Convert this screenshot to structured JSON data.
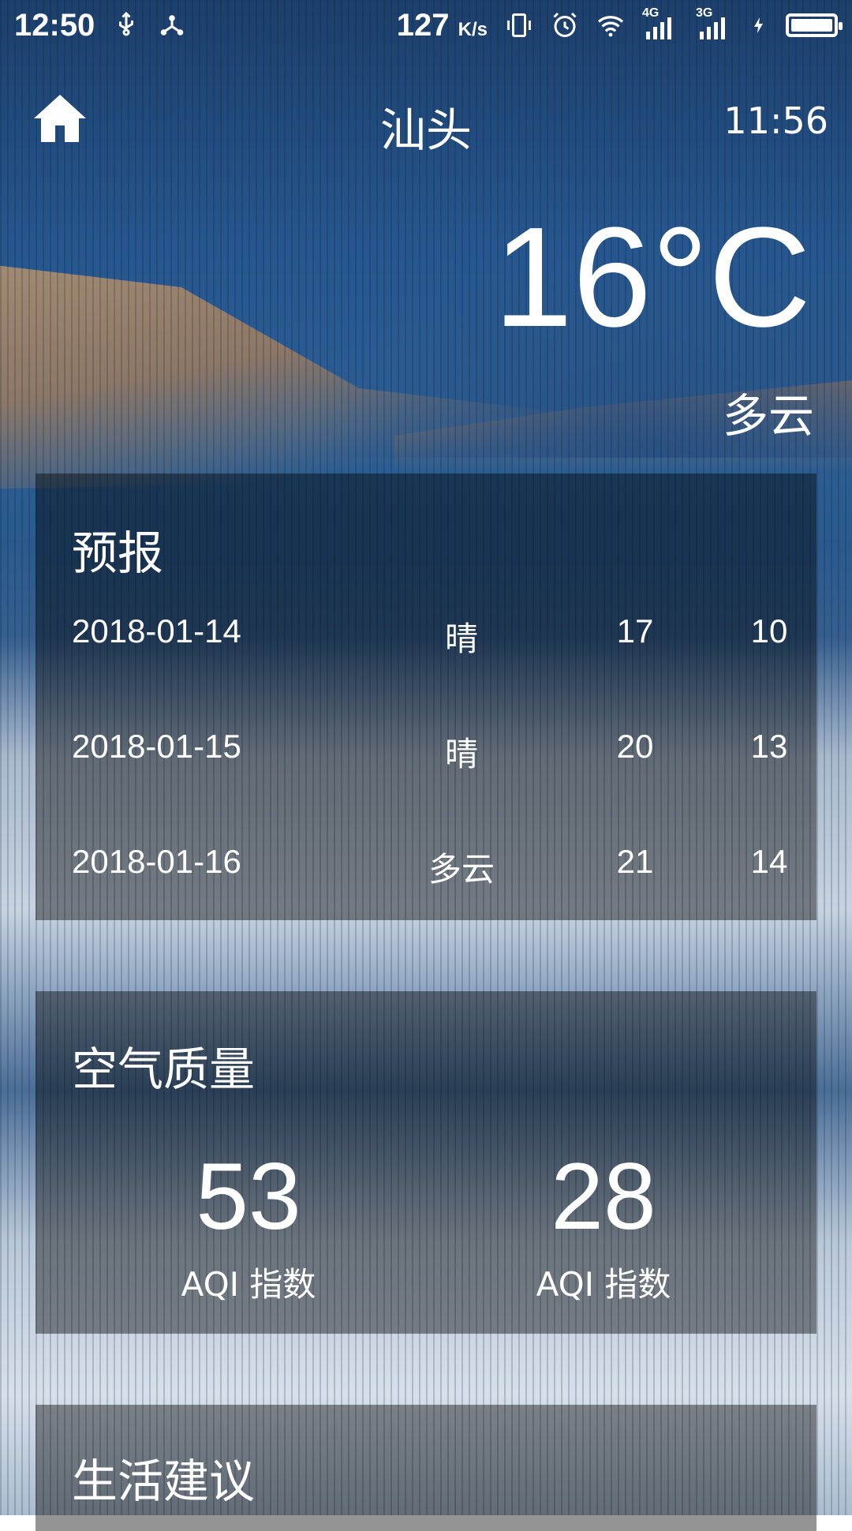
{
  "status_bar": {
    "time": "12:50",
    "net_speed": "127",
    "net_unit": "K/s",
    "signal_1": "4G",
    "signal_2": "3G"
  },
  "header": {
    "city": "汕头",
    "update_time": "11:56"
  },
  "current": {
    "temperature": "16°C",
    "condition": "多云"
  },
  "forecast": {
    "title": "预报",
    "rows": [
      {
        "date": "2018-01-14",
        "cond": "晴",
        "max": "17",
        "min": "10"
      },
      {
        "date": "2018-01-15",
        "cond": "晴",
        "max": "20",
        "min": "13"
      },
      {
        "date": "2018-01-16",
        "cond": "多云",
        "max": "21",
        "min": "14"
      }
    ]
  },
  "air_quality": {
    "title": "空气质量",
    "aqi": "53",
    "aqi_label": "AQI 指数",
    "pm25": "28",
    "pm25_label": "AQI 指数"
  },
  "suggestion": {
    "title": "生活建议"
  }
}
